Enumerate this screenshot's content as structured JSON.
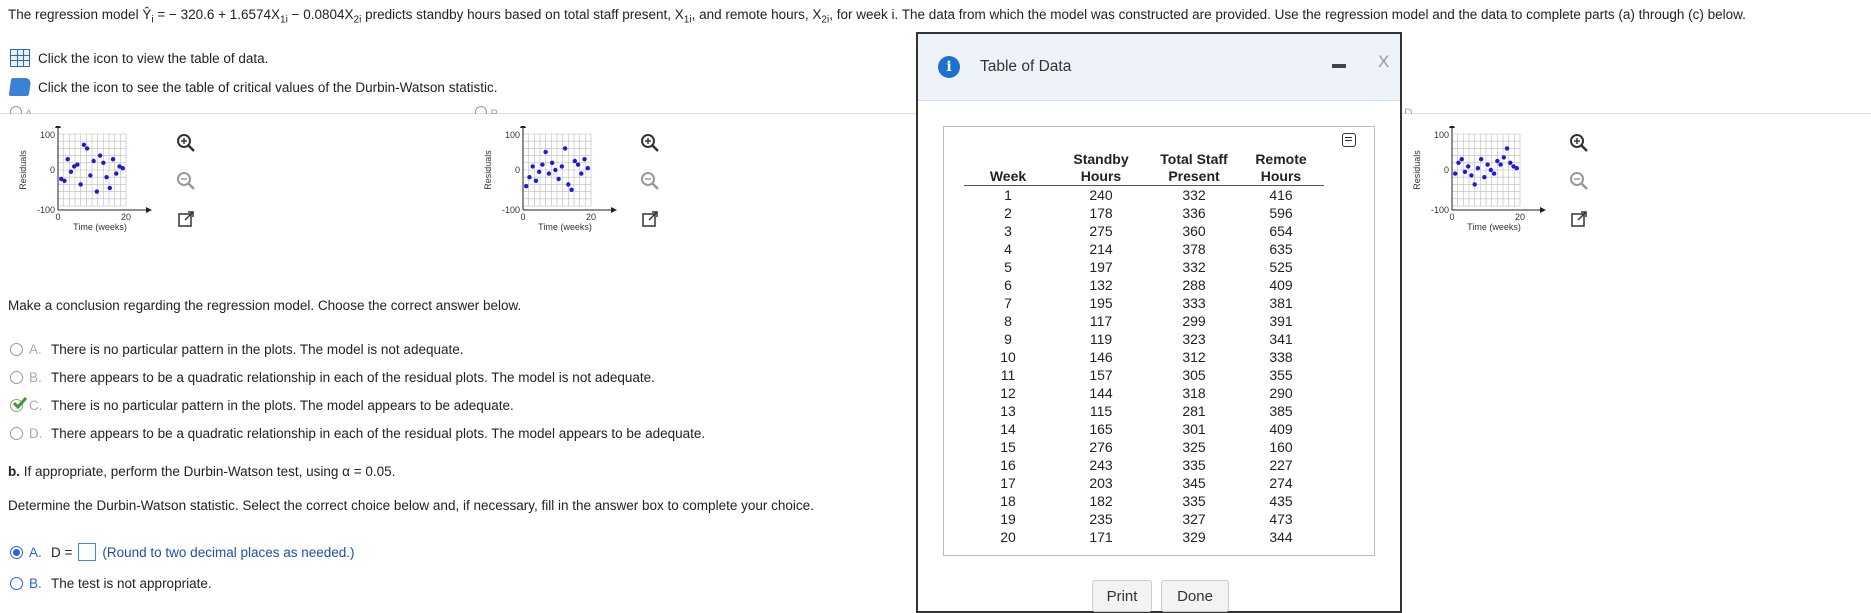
{
  "question": {
    "intro": "The regression model Ŷ",
    "sub_i": "i",
    "eq_part": " = − 320.6 + 1.6574X",
    "sub_1i": "1i",
    "eq_part2": " − 0.0804X",
    "sub_2i": "2i",
    "rest1": " predicts standby hours based on total staff present, X",
    "sub_1i_b": "1i",
    "rest2": ", and remote hours, X",
    "sub_2i_b": "2i",
    "rest3": ", for week i. The data from which the model was constructed are provided. Use the regression model and the data to complete parts (a) through (c) below."
  },
  "links": {
    "table_link": "Click the icon to view the table of data.",
    "dw_link": "Click the icon to see the table of critical values of the Durbin-Watson statistic."
  },
  "plots": {
    "ylabel": "Residuals",
    "xlabel": "Time (weeks)",
    "y_ticks": [
      "100",
      "0",
      "-100"
    ],
    "x_ticks": [
      "0",
      "20"
    ],
    "options": [
      {
        "label": "A."
      },
      {
        "label": "B."
      },
      {
        "label": "D."
      }
    ]
  },
  "conclusion": {
    "prompt": "Make a conclusion regarding the regression model. Choose the correct answer below.",
    "options": [
      {
        "letter": "A.",
        "text": "There is no particular pattern in the plots. The model is not adequate."
      },
      {
        "letter": "B.",
        "text": "There appears to be a quadratic relationship in each of the residual plots. The model is not adequate."
      },
      {
        "letter": "C.",
        "text": "There is no particular pattern in the plots. The model appears to be adequate."
      },
      {
        "letter": "D.",
        "text": "There appears to be a quadratic relationship in each of the residual plots. The model appears to be adequate."
      }
    ]
  },
  "part_b": {
    "bold": "b.",
    "text": " If appropriate, perform the Durbin-Watson test, using α = 0.05.",
    "determine": "Determine the Durbin-Watson statistic. Select the correct choice below and, if necessary, fill in the answer box to complete your choice.",
    "optA_letter": "A.",
    "optA_prefix": "D =",
    "optA_hint": "(Round to two decimal places as needed.)",
    "optB_letter": "B.",
    "optB_text": "The test is not appropriate."
  },
  "modal": {
    "title": "Table of Data",
    "close": "X",
    "headers": [
      [
        "Week",
        ""
      ],
      [
        "Standby",
        "Hours"
      ],
      [
        "Total Staff",
        "Present"
      ],
      [
        "Remote",
        "Hours"
      ]
    ],
    "rows": [
      [
        "1",
        "240",
        "332",
        "416"
      ],
      [
        "2",
        "178",
        "336",
        "596"
      ],
      [
        "3",
        "275",
        "360",
        "654"
      ],
      [
        "4",
        "214",
        "378",
        "635"
      ],
      [
        "5",
        "197",
        "332",
        "525"
      ],
      [
        "6",
        "132",
        "288",
        "409"
      ],
      [
        "7",
        "195",
        "333",
        "381"
      ],
      [
        "8",
        "117",
        "299",
        "391"
      ],
      [
        "9",
        "119",
        "323",
        "341"
      ],
      [
        "10",
        "146",
        "312",
        "338"
      ],
      [
        "11",
        "157",
        "305",
        "355"
      ],
      [
        "12",
        "144",
        "318",
        "290"
      ],
      [
        "13",
        "115",
        "281",
        "385"
      ],
      [
        "14",
        "165",
        "301",
        "409"
      ],
      [
        "15",
        "276",
        "325",
        "160"
      ],
      [
        "16",
        "243",
        "335",
        "227"
      ],
      [
        "17",
        "203",
        "345",
        "274"
      ],
      [
        "18",
        "182",
        "335",
        "435"
      ],
      [
        "19",
        "235",
        "327",
        "473"
      ],
      [
        "20",
        "171",
        "329",
        "344"
      ]
    ],
    "print": "Print",
    "done": "Done"
  },
  "colors": {
    "accent": "#2563eb",
    "points": "#1a1adb",
    "check": "#2e9e2e"
  }
}
